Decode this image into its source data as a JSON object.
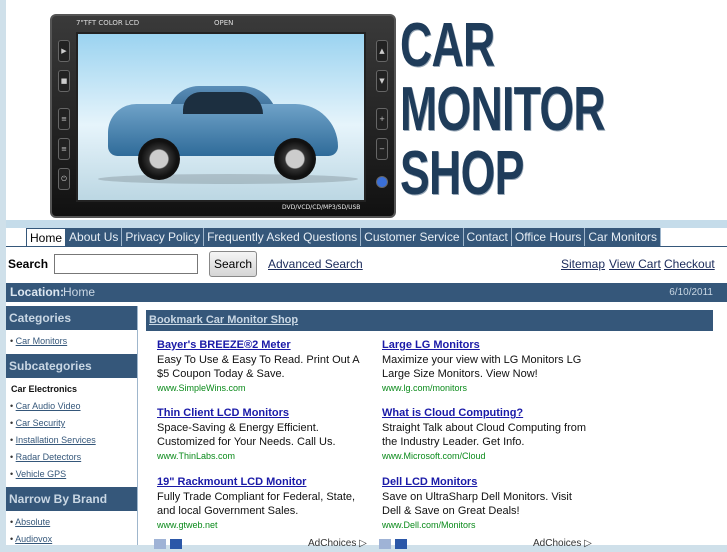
{
  "header": {
    "logo_lines": [
      "CAR",
      "MONITOR",
      "SHOP"
    ],
    "monitor": {
      "top_left_label": "7\"TFT COLOR LCD",
      "top_right_label": "OPEN",
      "bottom_label": "DVD/VCD/CD/MP3/SD/USB"
    }
  },
  "nav": {
    "tabs": [
      "Home",
      "About Us",
      "Privacy Policy",
      "Frequently Asked Questions",
      "Customer Service",
      "Contact",
      "Office Hours",
      "Car Monitors"
    ],
    "active": "Home"
  },
  "search": {
    "label": "Search",
    "input_value": "",
    "button_label": "Search",
    "advanced_link": "Advanced Search",
    "right_links": [
      "Sitemap",
      "View Cart",
      "Checkout"
    ]
  },
  "location": {
    "label": "Location:",
    "value": "Home",
    "date": "6/10/2011"
  },
  "sidebar": {
    "categories_title": "Categories",
    "categories": [
      "Car Monitors"
    ],
    "subcategories_title": "Subcategories",
    "subcategory_group": "Car Electronics",
    "subcategories": [
      "Car Audio Video",
      "Car Security",
      "Installation Services",
      "Radar Detectors",
      "Vehicle GPS"
    ],
    "brands_title": "Narrow By Brand",
    "brands": [
      "Absolute",
      "Audiovox"
    ]
  },
  "content": {
    "bookmark": "Bookmark Car Monitor Shop",
    "ads": [
      {
        "title": "Bayer's BREEZE®2 Meter",
        "text": "Easy To Use & Easy To Read. Print Out A $5 Coupon Today & Save.",
        "url": "www.SimpleWins.com"
      },
      {
        "title": "Large LG Monitors",
        "text": "Maximize your view with LG Monitors LG Large Size Monitors. View Now!",
        "url": "www.lg.com/monitors"
      },
      {
        "title": "Thin Client LCD Monitors",
        "text": "Space-Saving & Energy Efficient. Customized for Your Needs. Call Us.",
        "url": "www.ThinLabs.com"
      },
      {
        "title": "What is Cloud Computing?",
        "text": "Straight Talk about Cloud Computing from the Industry Leader. Get Info.",
        "url": "www.Microsoft.com/Cloud"
      },
      {
        "title": "19\" Rackmount LCD Monitor",
        "text": "Fully Trade Compliant for Federal, State, and local Government Sales.",
        "url": "www.gtweb.net"
      },
      {
        "title": "Dell LCD Monitors",
        "text": "Save on UltraSharp Dell Monitors. Visit Dell & Save on Great Deals!",
        "url": "www.Dell.com/Monitors"
      }
    ],
    "adchoices_label": "AdChoices"
  }
}
